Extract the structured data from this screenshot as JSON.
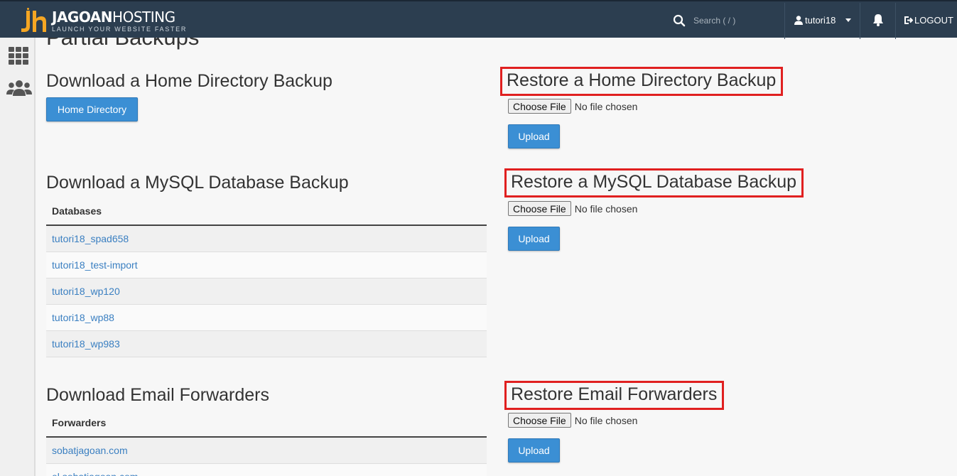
{
  "header": {
    "brand_bold": "JAGOAN",
    "brand_light": "HOSTING",
    "tagline": "LAUNCH YOUR WEBSITE FASTER",
    "search_placeholder": "Search ( / )",
    "username": "tutori18",
    "logout_label": "LOGOUT"
  },
  "sidebar": {
    "items": [
      {
        "icon": "grid-icon"
      },
      {
        "icon": "users-icon"
      }
    ]
  },
  "page": {
    "title": "Partial Backups"
  },
  "home": {
    "download_heading": "Download a Home Directory Backup",
    "download_button": "Home Directory",
    "restore_heading": "Restore a Home Directory Backup",
    "choose_file": "Choose File",
    "no_file": "No file chosen",
    "upload": "Upload"
  },
  "mysql": {
    "download_heading": "Download a MySQL Database Backup",
    "column_header": "Databases",
    "databases": [
      "tutori18_spad658",
      "tutori18_test-import",
      "tutori18_wp120",
      "tutori18_wp88",
      "tutori18_wp983"
    ],
    "restore_heading": "Restore a MySQL Database Backup",
    "choose_file": "Choose File",
    "no_file": "No file chosen",
    "upload": "Upload"
  },
  "email": {
    "download_heading": "Download Email Forwarders",
    "column_header": "Forwarders",
    "forwarders": [
      "sobatjagoan.com",
      "el.sobatjagoan.com"
    ],
    "restore_heading": "Restore Email Forwarders",
    "choose_file": "Choose File",
    "no_file": "No file chosen",
    "upload": "Upload"
  },
  "colors": {
    "topbar": "#2c3e50",
    "accent": "#3b8fd4",
    "link": "#3a7fc1",
    "highlight_box": "#e02020",
    "logo_orange": "#f5a623"
  }
}
